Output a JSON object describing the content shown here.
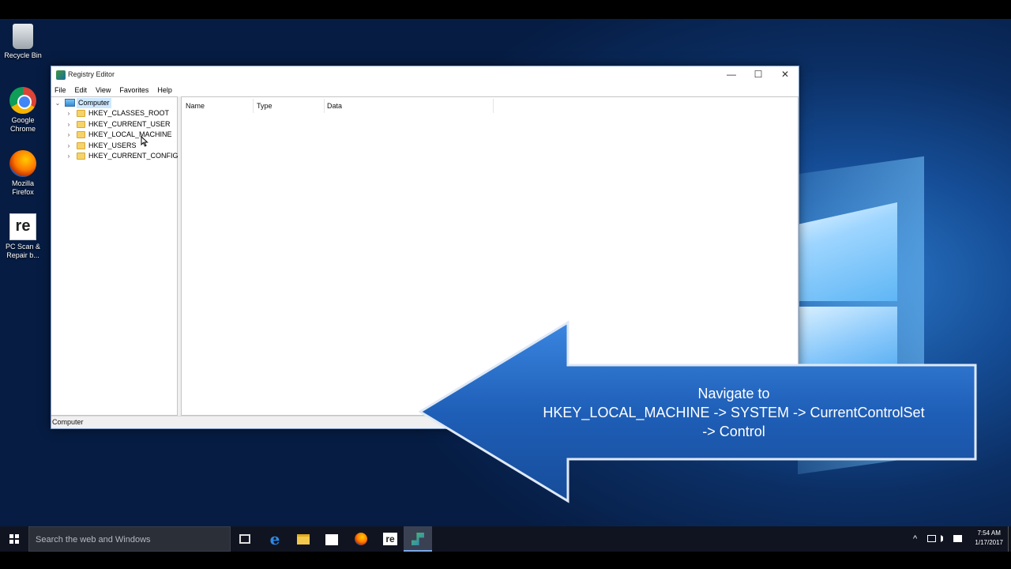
{
  "desktop": {
    "icons": [
      {
        "label": "Recycle Bin",
        "icon": "recycle-bin-icon"
      },
      {
        "label": "Google Chrome",
        "icon": "chrome-icon"
      },
      {
        "label": "Mozilla Firefox",
        "icon": "firefox-icon"
      },
      {
        "label": "PC Scan & Repair b...",
        "icon": "pc-scan-repair-icon"
      }
    ]
  },
  "window": {
    "title": "Registry Editor",
    "controls": {
      "minimize": "—",
      "maximize": "☐",
      "close": "✕"
    },
    "menu": [
      "File",
      "Edit",
      "View",
      "Favorites",
      "Help"
    ],
    "tree": {
      "root": {
        "label": "Computer",
        "expander": "⌄"
      },
      "hives": [
        {
          "label": "HKEY_CLASSES_ROOT",
          "expander": "›"
        },
        {
          "label": "HKEY_CURRENT_USER",
          "expander": "›"
        },
        {
          "label": "HKEY_LOCAL_MACHINE",
          "expander": "›"
        },
        {
          "label": "HKEY_USERS",
          "expander": "›"
        },
        {
          "label": "HKEY_CURRENT_CONFIG",
          "expander": "›"
        }
      ]
    },
    "list_columns": [
      "Name",
      "Type",
      "Data"
    ],
    "status_text": "Computer"
  },
  "callout": {
    "lines": [
      "Navigate to",
      "HKEY_LOCAL_MACHINE -> SYSTEM -> CurrentControlSet",
      "-> Control"
    ]
  },
  "taskbar": {
    "search_placeholder": "Search the web and Windows",
    "apps": [
      "task-view-icon",
      "edge-icon",
      "file-explorer-icon",
      "store-icon",
      "firefox-icon",
      "pc-scan-repair-icon",
      "registry-editor-icon"
    ],
    "edge_glyph": "e",
    "pcscan_glyph": "re",
    "tray": {
      "chevron": "^",
      "time": "7:54 AM",
      "date": "1/17/2017"
    }
  },
  "colors": {
    "accent": "#2e6fc4",
    "callout_fill": "#1f5fb8",
    "taskbar": "#101420"
  }
}
